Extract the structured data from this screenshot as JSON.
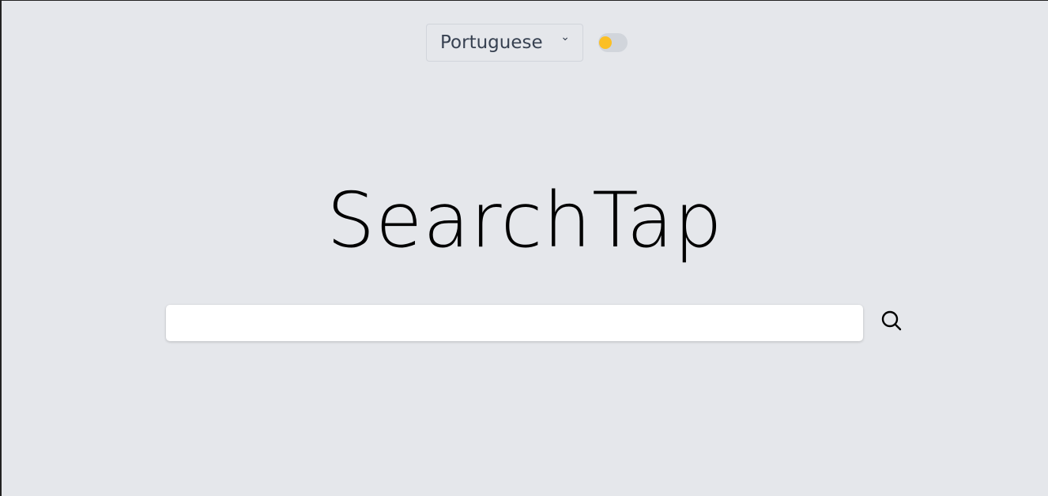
{
  "language_select": {
    "value": "Portuguese"
  },
  "theme_toggle": {
    "on": false,
    "knob_color": "#fbbf24"
  },
  "logo": {
    "title": "SearchTap"
  },
  "search": {
    "value": "",
    "placeholder": ""
  },
  "icons": {
    "search_button": "search-icon",
    "dropdown": "chevron-down-icon"
  }
}
